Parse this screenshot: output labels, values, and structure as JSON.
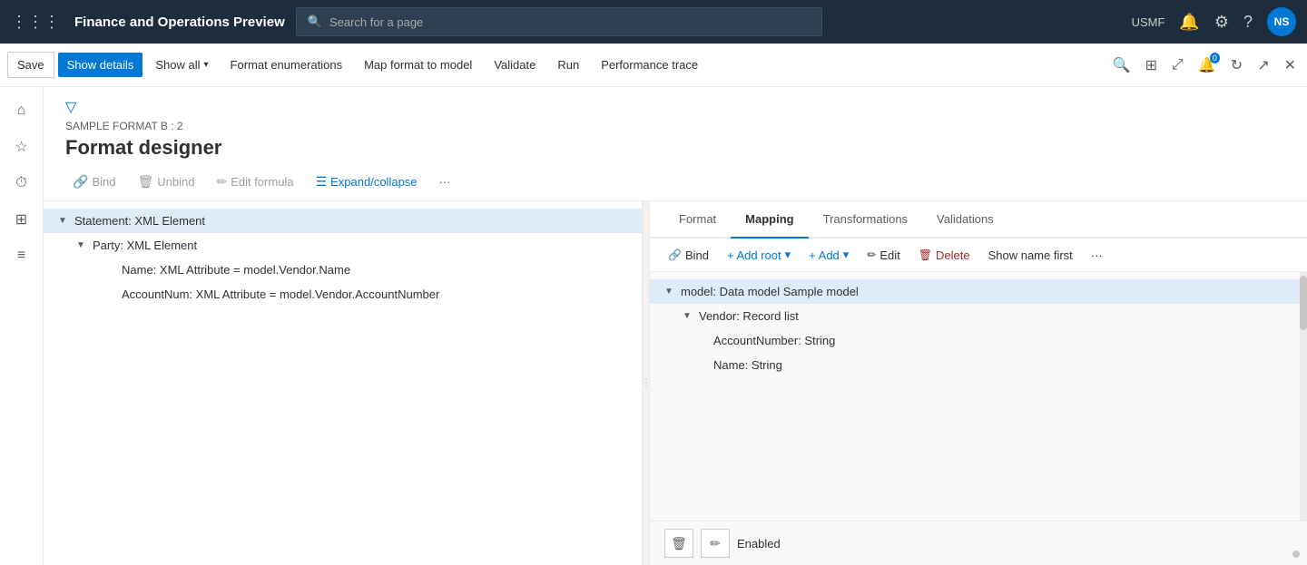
{
  "app": {
    "title": "Finance and Operations Preview",
    "avatar": "NS",
    "org": "USMF"
  },
  "search": {
    "placeholder": "Search for a page"
  },
  "toolbar": {
    "save_label": "Save",
    "show_details_label": "Show details",
    "show_all_label": "Show all",
    "format_enumerations_label": "Format enumerations",
    "map_format_to_model_label": "Map format to model",
    "validate_label": "Validate",
    "run_label": "Run",
    "performance_trace_label": "Performance trace"
  },
  "page_header": {
    "breadcrumb": "SAMPLE FORMAT B : 2",
    "title": "Format designer",
    "sub_toolbar": {
      "bind_label": "Bind",
      "unbind_label": "Unbind",
      "edit_formula_label": "Edit formula",
      "expand_collapse_label": "Expand/collapse",
      "more_label": "···"
    }
  },
  "left_tree": {
    "items": [
      {
        "label": "Statement: XML Element",
        "level": 0,
        "has_arrow": true,
        "selected": true
      },
      {
        "label": "Party: XML Element",
        "level": 1,
        "has_arrow": true,
        "selected": false
      },
      {
        "label": "Name: XML Attribute = model.Vendor.Name",
        "level": 2,
        "has_arrow": false,
        "selected": false
      },
      {
        "label": "AccountNum: XML Attribute = model.Vendor.AccountNumber",
        "level": 2,
        "has_arrow": false,
        "selected": false
      }
    ]
  },
  "right_pane": {
    "tabs": [
      {
        "label": "Format",
        "active": false
      },
      {
        "label": "Mapping",
        "active": true
      },
      {
        "label": "Transformations",
        "active": false
      },
      {
        "label": "Validations",
        "active": false
      }
    ],
    "toolbar": {
      "bind_label": "Bind",
      "add_root_label": "+ Add root",
      "add_label": "+ Add",
      "edit_label": "Edit",
      "delete_label": "Delete",
      "show_name_first_label": "Show name first",
      "more_label": "···"
    },
    "tree": {
      "items": [
        {
          "label": "model: Data model Sample model",
          "level": 0,
          "has_arrow": true,
          "selected": true
        },
        {
          "label": "Vendor: Record list",
          "level": 1,
          "has_arrow": true,
          "selected": false
        },
        {
          "label": "AccountNumber: String",
          "level": 2,
          "has_arrow": false,
          "selected": false
        },
        {
          "label": "Name: String",
          "level": 2,
          "has_arrow": false,
          "selected": false
        }
      ]
    },
    "bottom": {
      "enabled_label": "Enabled"
    }
  },
  "sidebar_icons": [
    {
      "name": "home-icon",
      "symbol": "⌂",
      "active": false
    },
    {
      "name": "star-icon",
      "symbol": "☆",
      "active": false
    },
    {
      "name": "recent-icon",
      "symbol": "⏱",
      "active": false
    },
    {
      "name": "grid-icon",
      "symbol": "⊞",
      "active": false
    },
    {
      "name": "list-icon",
      "symbol": "≡",
      "active": false
    }
  ]
}
